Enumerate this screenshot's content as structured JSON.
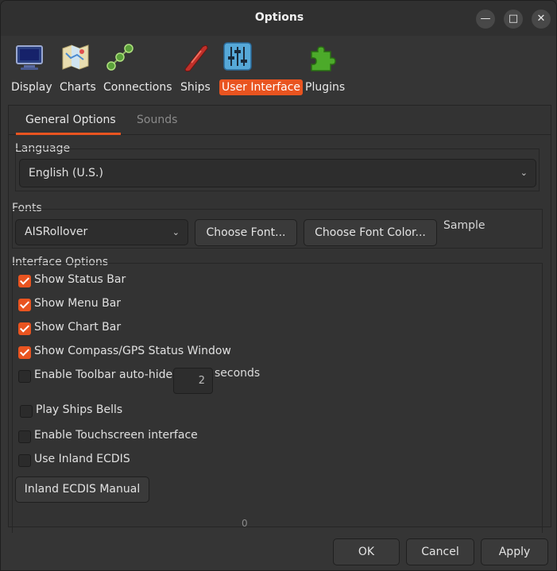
{
  "window": {
    "title": "Options"
  },
  "toolbar": {
    "items": [
      {
        "label": "Display",
        "icon": "monitor-icon"
      },
      {
        "label": "Charts",
        "icon": "charts-map-icon"
      },
      {
        "label": "Connections",
        "icon": "connections-icon"
      },
      {
        "label": "Ships",
        "icon": "ship-icon"
      },
      {
        "label": "User Interface",
        "icon": "sliders-icon",
        "active": true
      },
      {
        "label": "Plugins",
        "icon": "puzzle-icon"
      }
    ]
  },
  "tabs": [
    {
      "label": "General Options",
      "selected": true
    },
    {
      "label": "Sounds",
      "selected": false
    }
  ],
  "language": {
    "group_label": "Language",
    "selected": "English (U.S.)"
  },
  "fonts": {
    "group_label": "Fonts",
    "selected": "AISRollover",
    "choose_font": "Choose Font...",
    "choose_color": "Choose Font Color...",
    "sample": "Sample"
  },
  "interface": {
    "group_label": "Interface Options",
    "show_status_bar": "Show Status Bar",
    "show_menu_bar": "Show Menu Bar",
    "show_chart_bar": "Show Chart Bar",
    "show_compass": "Show Compass/GPS Status Window",
    "toolbar_autohide": "Enable Toolbar auto-hide",
    "autohide_seconds": "2",
    "seconds_label": "seconds",
    "play_bells": "Play Ships Bells",
    "touchscreen": "Enable Touchscreen interface",
    "inland_ecdis": "Use Inland ECDIS",
    "inland_manual": "Inland ECDIS Manual",
    "bottom_value": "0"
  },
  "footer": {
    "ok": "OK",
    "cancel": "Cancel",
    "apply": "Apply"
  },
  "colors": {
    "accent": "#e95420",
    "background": "#353535"
  }
}
